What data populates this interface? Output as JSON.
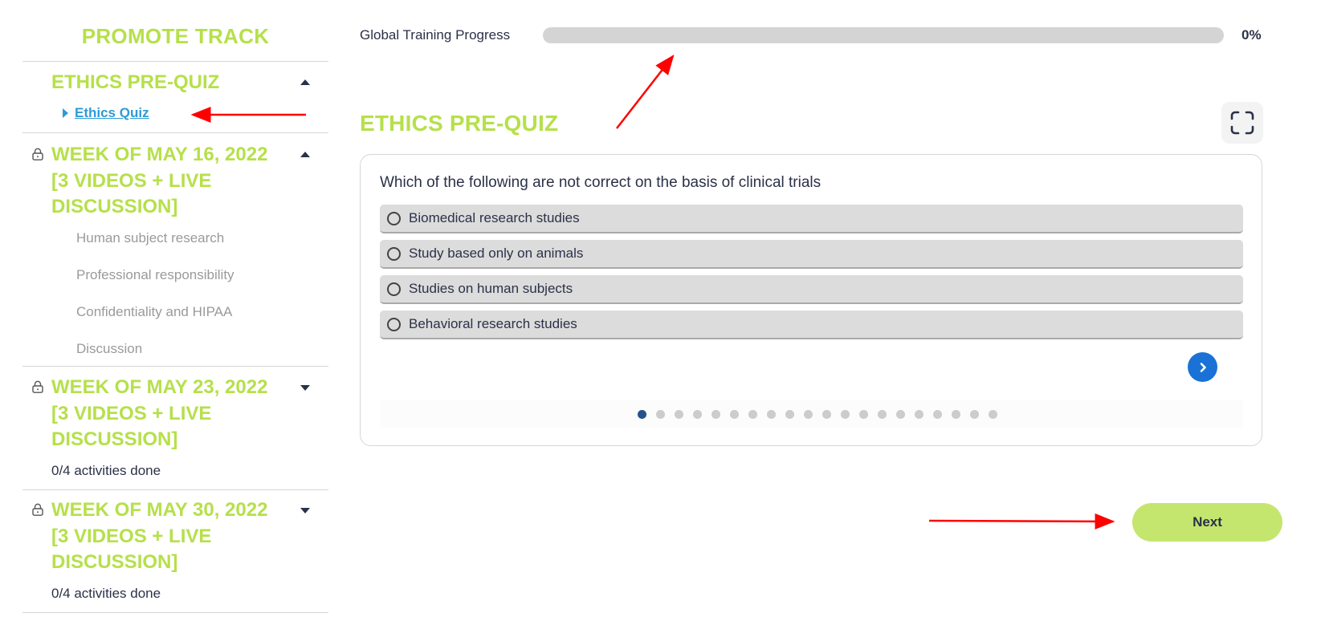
{
  "sidebar": {
    "track_title": "PROMOTE TRACK",
    "sections": [
      {
        "title": "ETHICS PRE-QUIZ",
        "locked": false,
        "expanded": true,
        "items": [
          {
            "label": "Ethics Quiz",
            "active": true
          }
        ]
      },
      {
        "title": "WEEK OF MAY 16, 2022 [3 VIDEOS + LIVE DISCUSSION]",
        "title_lines": [
          "WEEK OF MAY 16, 2022",
          "[3 VIDEOS + LIVE",
          "DISCUSSION]"
        ],
        "locked": true,
        "expanded": true,
        "items": [
          {
            "label": "Human subject research"
          },
          {
            "label": "Professional responsibility"
          },
          {
            "label": "Confidentiality and HIPAA"
          },
          {
            "label": "Discussion"
          }
        ]
      },
      {
        "title": "WEEK OF MAY 23, 2022 [3 VIDEOS + LIVE DISCUSSION]",
        "title_lines": [
          "WEEK OF MAY 23, 2022",
          "[3 VIDEOS + LIVE",
          "DISCUSSION]"
        ],
        "locked": true,
        "expanded": false,
        "status": "0/4 activities done"
      },
      {
        "title": "WEEK OF MAY 30, 2022 [3 VIDEOS + LIVE DISCUSSION]",
        "title_lines": [
          "WEEK OF MAY 30, 2022",
          "[3 VIDEOS + LIVE",
          "DISCUSSION]"
        ],
        "locked": true,
        "expanded": false,
        "status": "0/4 activities done"
      }
    ]
  },
  "progress": {
    "label": "Global Training Progress",
    "value_percent": 0,
    "value_text": "0%"
  },
  "main": {
    "heading": "ETHICS PRE-QUIZ",
    "fullscreen_icon": "fullscreen-icon"
  },
  "quiz": {
    "question": "Which of the following are not correct on the basis of clinical trials",
    "options": [
      "Biomedical research studies",
      "Study based only on animals",
      "Studies on human subjects",
      "Behavioral research studies"
    ],
    "total_questions": 20,
    "current_question": 1,
    "next_icon": "chevron-right-icon"
  },
  "footer": {
    "next_label": "Next"
  },
  "colors": {
    "brand_green": "#b6e04a",
    "next_button": "#c4e66e",
    "link_blue": "#2e9bd6",
    "nav_circle_blue": "#1a72d6",
    "active_dot": "#25548a",
    "annotation_red": "#ff0000"
  }
}
